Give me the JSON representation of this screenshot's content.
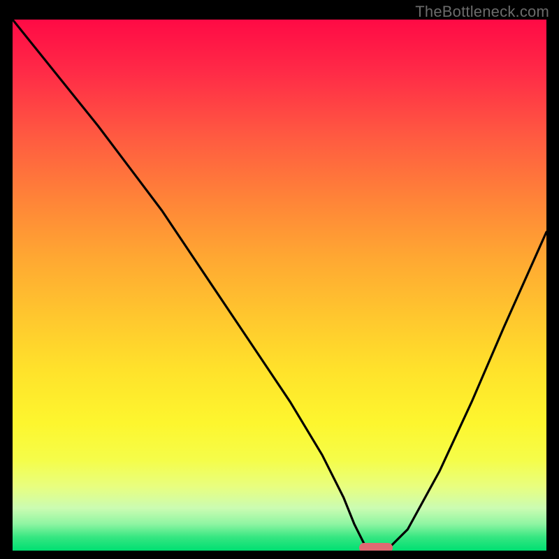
{
  "watermark": {
    "text": "TheBottleneck.com"
  },
  "colors": {
    "curve": "#000000",
    "marker": "#e06a72",
    "frame_bg": "#000000"
  },
  "chart_data": {
    "type": "line",
    "title": "",
    "xlabel": "",
    "ylabel": "",
    "xlim": [
      0,
      100
    ],
    "ylim": [
      0,
      100
    ],
    "grid": false,
    "legend": false,
    "series": [
      {
        "name": "bottleneck-curve",
        "x": [
          0,
          8,
          16,
          22,
          28,
          36,
          44,
          52,
          58,
          62,
          64,
          66,
          68,
          70,
          74,
          80,
          86,
          92,
          100
        ],
        "values": [
          100,
          90,
          80,
          72,
          64,
          52,
          40,
          28,
          18,
          10,
          5,
          1,
          0,
          0,
          4,
          15,
          28,
          42,
          60
        ]
      }
    ],
    "marker": {
      "x": 68,
      "y": 0,
      "label": ""
    }
  }
}
